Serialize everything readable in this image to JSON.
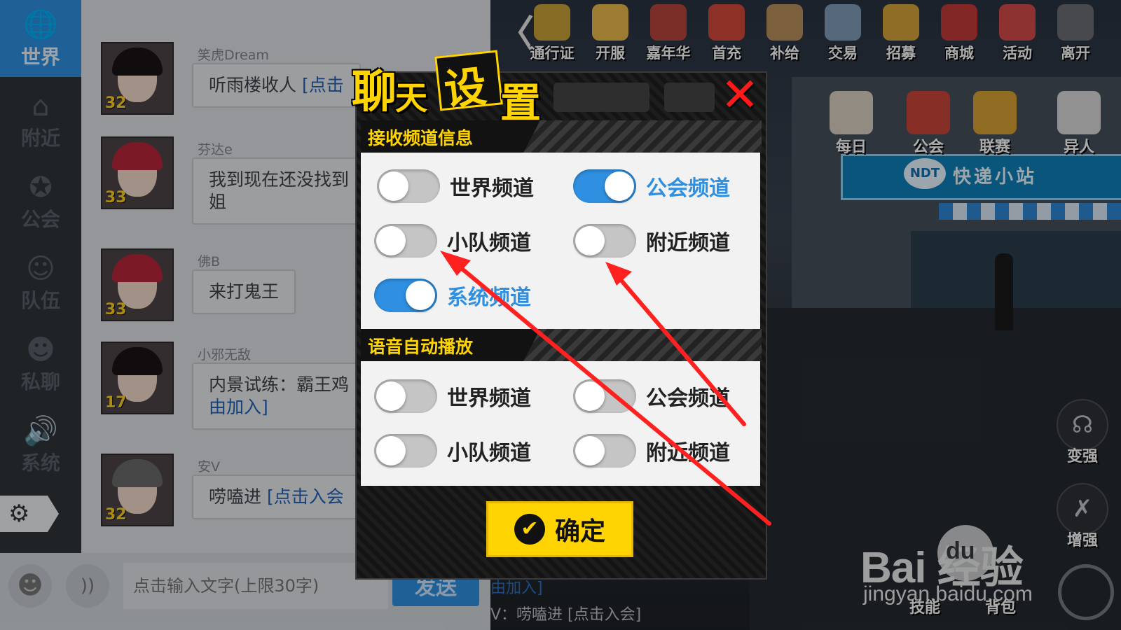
{
  "sidebar": {
    "items": [
      {
        "label": "世界",
        "icon": "globe-icon",
        "glyph": "🌐"
      },
      {
        "label": "附近",
        "icon": "home-icon",
        "glyph": "⌂"
      },
      {
        "label": "公会",
        "icon": "guild-icon",
        "glyph": "✪"
      },
      {
        "label": "队伍",
        "icon": "team-icon",
        "glyph": "☺"
      },
      {
        "label": "私聊",
        "icon": "private-chat-icon",
        "glyph": "☻"
      },
      {
        "label": "系统",
        "icon": "speaker-icon",
        "glyph": "🔊"
      }
    ],
    "settings_glyph": "⚙"
  },
  "chat": {
    "messages": [
      {
        "user": "笑虎Dream",
        "level": "32",
        "text": "听雨楼收人 ",
        "link": "[点击"
      },
      {
        "user": "芬达e",
        "level": "33",
        "text": "我到现在还没找到\n姐",
        "link": ""
      },
      {
        "user": "佛B",
        "level": "33",
        "text": "来打鬼王",
        "link": ""
      },
      {
        "user": "小邪无敌",
        "level": "17",
        "text": "内景试练：霸王鸡\n",
        "link": "由加入]"
      },
      {
        "user": "安V",
        "level": "32",
        "text": "唠嗑进 ",
        "link": "[点击入会"
      }
    ]
  },
  "input": {
    "placeholder": "点击输入文字(上限30字)",
    "send_label": "发送",
    "emoji_glyph": "☻",
    "voice_glyph": "))",
    "behind_line1": "由加入]",
    "behind_line2": "V：唠嗑进 [点击入会]"
  },
  "topbar": {
    "back_glyph": "〈",
    "icons": [
      {
        "label": "通行证",
        "color": "#c9a13a"
      },
      {
        "label": "开服",
        "color": "#e8b94a"
      },
      {
        "label": "嘉年华",
        "color": "#b8443c"
      },
      {
        "label": "首充",
        "color": "#d24a3a"
      },
      {
        "label": "补给",
        "color": "#b9905c"
      },
      {
        "label": "交易",
        "color": "#7f9db8"
      },
      {
        "label": "招募",
        "color": "#d4a53a"
      },
      {
        "label": "商城",
        "color": "#c23a3a"
      },
      {
        "label": "活动",
        "color": "#d44a4a"
      },
      {
        "label": "离开",
        "color": "#6a6e74"
      }
    ],
    "row2": [
      {
        "label": "每日",
        "color": "#d8d0c0"
      },
      {
        "label": "公会",
        "color": "#c9463a"
      },
      {
        "label": "联赛",
        "color": "#d6a233"
      },
      {
        "label": "异人",
        "color": "#d8d8d8"
      }
    ]
  },
  "scene": {
    "store_logo": "NDT",
    "store_text": "快递小站"
  },
  "controls": [
    {
      "label": "变强",
      "glyph": "☊"
    },
    {
      "label": "增强",
      "glyph": "✗"
    },
    {
      "label": "技能",
      "glyph": ""
    },
    {
      "label": "背包",
      "glyph": ""
    }
  ],
  "dialog": {
    "title_chars": [
      "聊",
      "天",
      "设",
      "置"
    ],
    "close_glyph": "✕",
    "section_receive": {
      "title": "接收频道信息",
      "toggles": [
        {
          "label": "世界频道",
          "on": false
        },
        {
          "label": "公会频道",
          "on": true
        },
        {
          "label": "小队频道",
          "on": false
        },
        {
          "label": "附近频道",
          "on": false
        },
        {
          "label": "系统频道",
          "on": true
        }
      ]
    },
    "section_voice": {
      "title": "语音自动播放",
      "toggles": [
        {
          "label": "世界频道",
          "on": false
        },
        {
          "label": "公会频道",
          "on": false
        },
        {
          "label": "小队频道",
          "on": false
        },
        {
          "label": "附近频道",
          "on": false
        }
      ]
    },
    "confirm_label": "确定",
    "confirm_glyph": "✔"
  },
  "watermark": {
    "brand": "Bai  经验",
    "paw_text": "du",
    "url": "jingyan.baidu.com"
  },
  "colors": {
    "accent_blue": "#2f8fe0",
    "accent_yellow": "#ffd400",
    "close_red": "#ff1a1a",
    "arrow_red": "#ff2020"
  }
}
